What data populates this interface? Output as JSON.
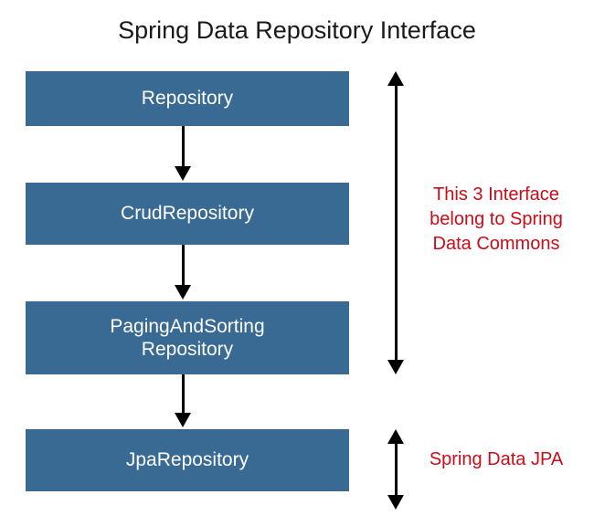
{
  "title": "Spring Data Repository Interface",
  "boxes": {
    "repository": "Repository",
    "crud": "CrudRepository",
    "paging_line1": "PagingAndSorting",
    "paging_line2": "Repository",
    "jpa": "JpaRepository"
  },
  "annotations": {
    "commons_line1": "This 3 Interface",
    "commons_line2": "belong to Spring",
    "commons_line3": "Data Commons",
    "jpa": "Spring Data JPA"
  },
  "colors": {
    "box_bg": "#386a93",
    "box_text": "#ffffff",
    "annotation_text": "#cc0b18",
    "arrow": "#000000"
  }
}
